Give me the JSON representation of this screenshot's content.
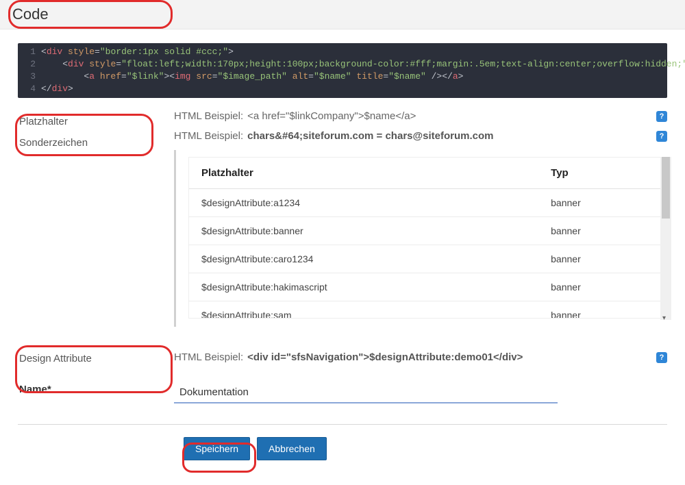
{
  "title": "Code",
  "code": {
    "lines": [
      "1",
      "2",
      "3",
      "4"
    ],
    "line1": {
      "a": "<",
      "b": "div ",
      "c": "style",
      "d": "=",
      "e": "\"border:1px solid #ccc;\"",
      "f": ">"
    },
    "line2": {
      "a": "    <",
      "b": "div ",
      "c": "style",
      "d": "=",
      "e": "\"float:left;width:170px;height:100px;background-color:#fff;margin:.5em;text-align:center;overflow:hidden;\"",
      "f": ">"
    },
    "line3": {
      "a": "        <",
      "b": "a ",
      "c": "href",
      "d": "=",
      "e": "\"$link\"",
      "f": "><",
      "g": "img ",
      "h": "src",
      "i": "=",
      "j": "\"$image_path\"",
      "k": " alt",
      "l": "=",
      "m": "\"$name\"",
      "n": " title",
      "o": "=",
      "p": "\"$name\"",
      "q": " /></",
      "r": "a",
      "s": ">"
    },
    "line4": {
      "a": "</",
      "b": "div",
      "c": ">"
    }
  },
  "sidebar1": {
    "item1": "Platzhalter",
    "item2": "Sonderzeichen"
  },
  "example1": {
    "label": "HTML Beispiel: ",
    "code": "<a href=\"$linkCompany\">$name</a>"
  },
  "example2": {
    "label": "HTML Beispiel: ",
    "bold": "chars&#64;siteforum.com = chars@siteforum.com"
  },
  "table": {
    "col1": "Platzhalter",
    "col2": "Typ",
    "rows": [
      {
        "p": "$designAttribute:a1234",
        "t": "banner"
      },
      {
        "p": "$designAttribute:banner",
        "t": "banner"
      },
      {
        "p": "$designAttribute:caro1234",
        "t": "banner"
      },
      {
        "p": "$designAttribute:hakimascript",
        "t": "banner"
      },
      {
        "p": "$designAttribute:sam",
        "t": "banner"
      }
    ]
  },
  "sidebar2": {
    "heading": "Design Attribute",
    "nameLabel": "Name*"
  },
  "example3": {
    "label": "HTML Beispiel: ",
    "bold": "<div id=\"sfsNavigation\">$designAttribute:demo01</div>"
  },
  "nameInput": {
    "value": "Dokumentation"
  },
  "buttons": {
    "save": "Speichern",
    "cancel": "Abbrechen"
  },
  "helpGlyph": "?"
}
